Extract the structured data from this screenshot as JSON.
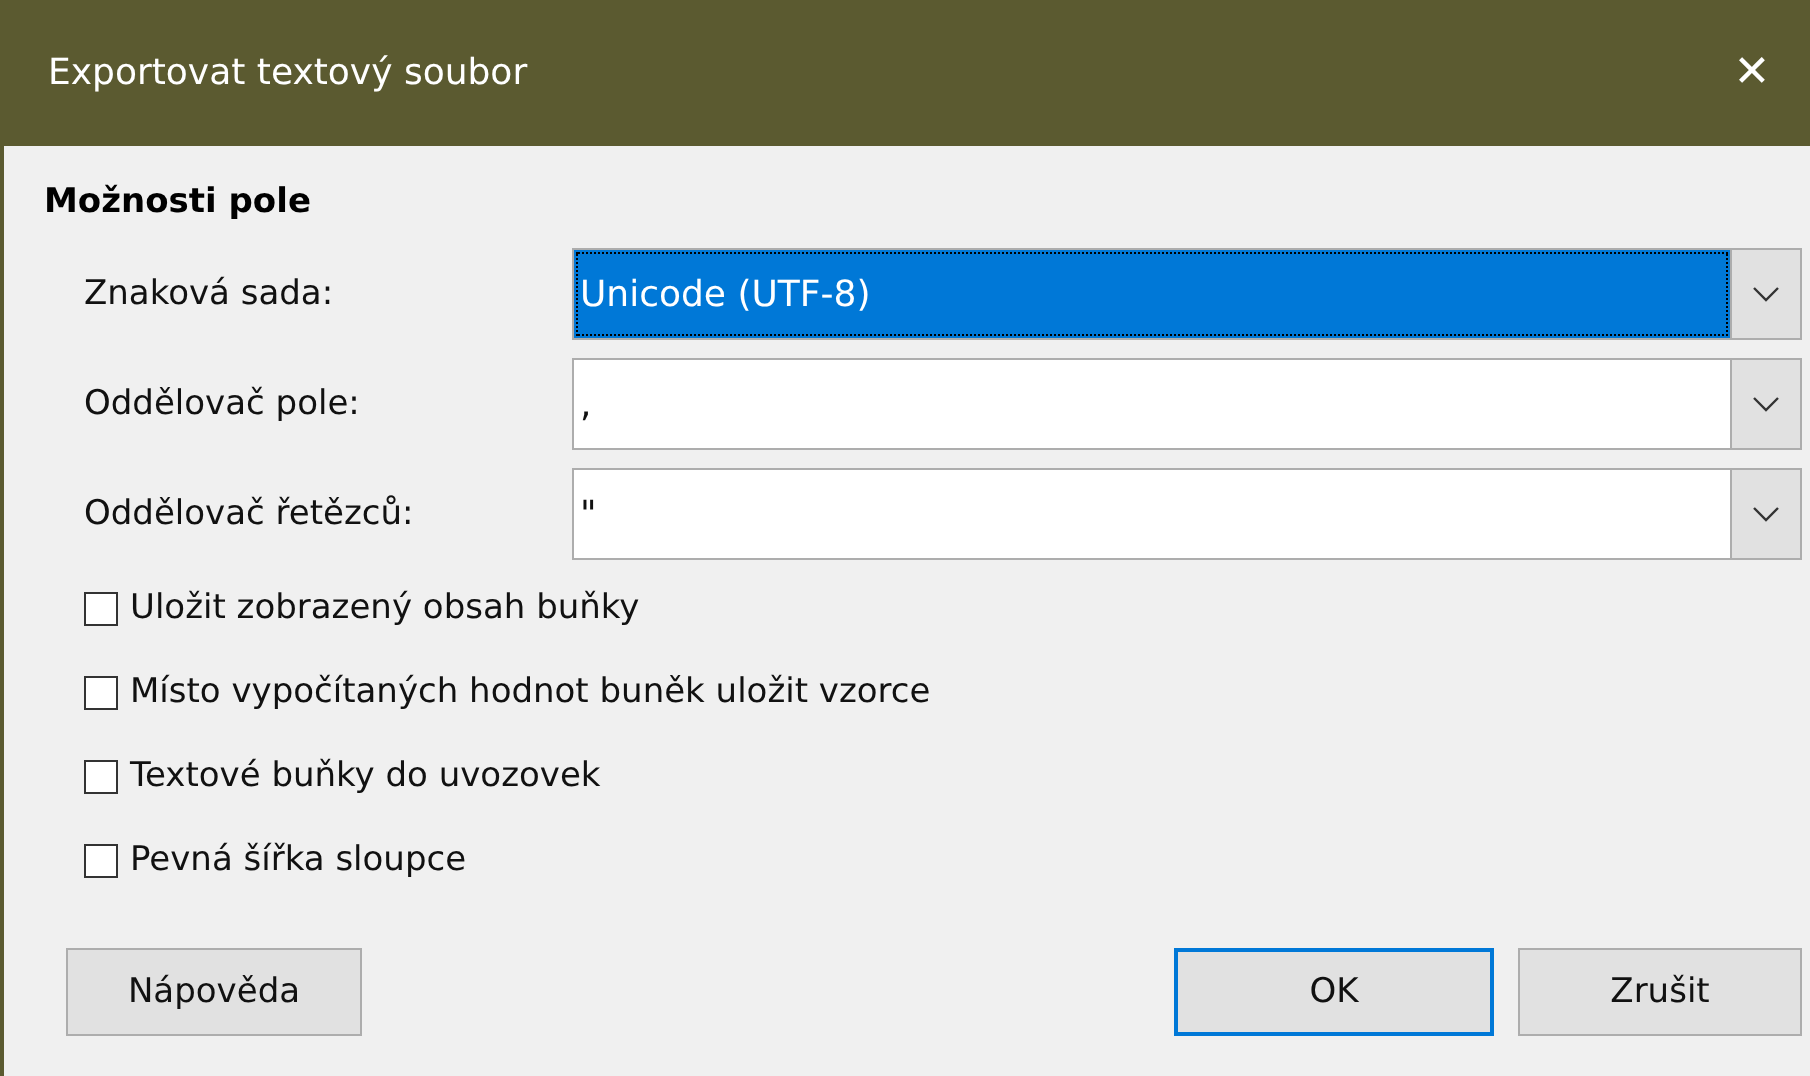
{
  "window": {
    "title": "Exportovat textový soubor",
    "close": "✕"
  },
  "section": {
    "title": "Možnosti pole"
  },
  "fields": [
    {
      "label": "Znaková sada:",
      "value": "Unicode (UTF-8)",
      "selected": true
    },
    {
      "label": "Oddělovač pole:",
      "value": ",",
      "selected": false
    },
    {
      "label": "Oddělovač řetězců:",
      "value": "\"",
      "selected": false
    }
  ],
  "options": [
    {
      "label": "Uložit zobrazený obsah buňky",
      "checked": false
    },
    {
      "label": "Místo vypočítaných hodnot buněk uložit vzorce",
      "checked": false
    },
    {
      "label": "Textové buňky do uvozovek",
      "checked": false
    },
    {
      "label": "Pevná šířka sloupce",
      "checked": false
    }
  ],
  "buttons": [
    {
      "label": "Nápověda",
      "kind": "help",
      "focused": false
    },
    {
      "label": "OK",
      "kind": "ok",
      "focused": true
    },
    {
      "label": "Zrušit",
      "kind": "cancel",
      "focused": false
    }
  ]
}
